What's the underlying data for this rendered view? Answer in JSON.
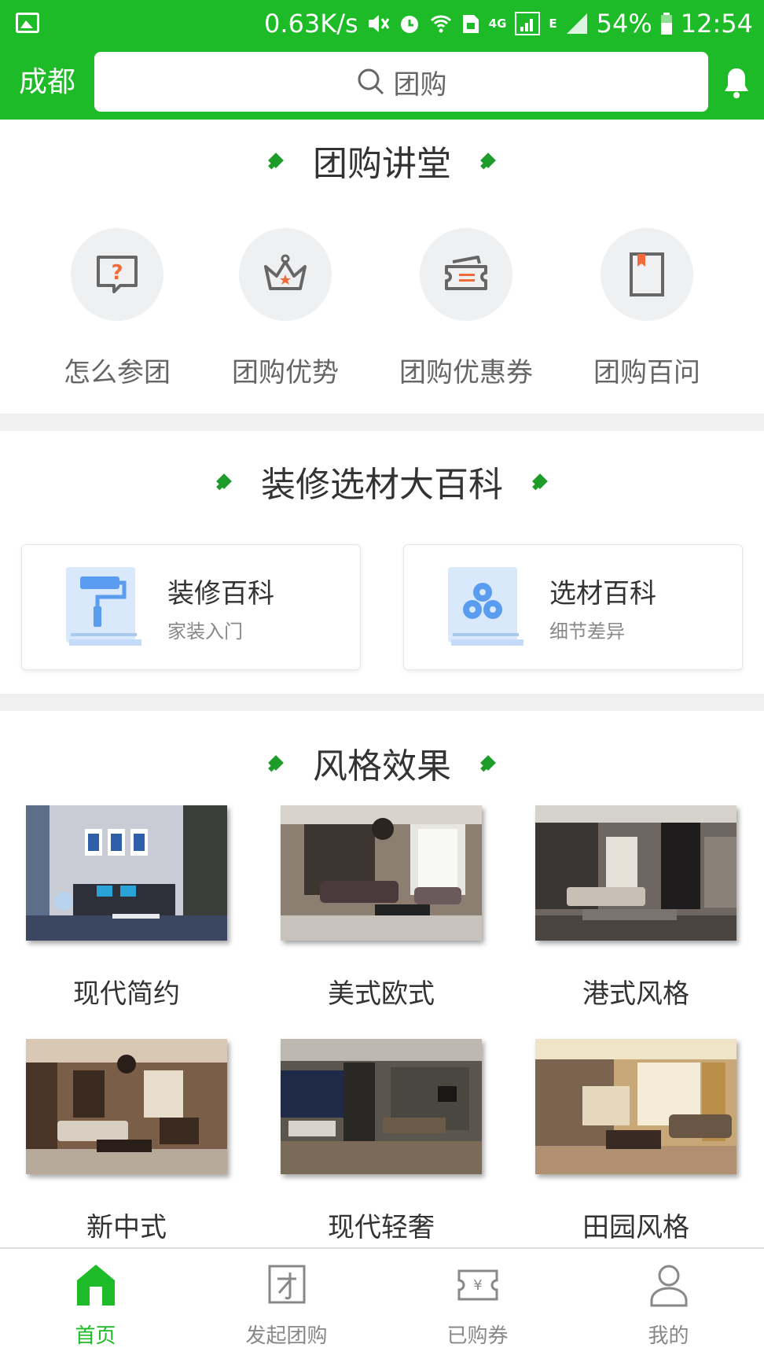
{
  "status_bar": {
    "net_speed": "0.63K/s",
    "net_type": "4G",
    "edge": "E",
    "battery": "54%",
    "time": "12:54"
  },
  "header": {
    "city": "成都",
    "search_placeholder": "团购",
    "accent_color": "#1dbb27"
  },
  "lecture": {
    "title": "团购讲堂",
    "items": [
      {
        "label": "怎么参团",
        "icon": "question-bubble-icon"
      },
      {
        "label": "团购优势",
        "icon": "crown-icon"
      },
      {
        "label": "团购优惠券",
        "icon": "coupon-icon"
      },
      {
        "label": "团购百问",
        "icon": "book-icon"
      }
    ]
  },
  "encyclopedia": {
    "title": "装修选材大百科",
    "cards": [
      {
        "title": "装修百科",
        "subtitle": "家装入门",
        "icon": "paint-roller-icon"
      },
      {
        "title": "选材百科",
        "subtitle": "细节差异",
        "icon": "material-rolls-icon"
      }
    ]
  },
  "styles": {
    "title": "风格效果",
    "items": [
      {
        "label": "现代简约"
      },
      {
        "label": "美式欧式"
      },
      {
        "label": "港式风格"
      },
      {
        "label": "新中式"
      },
      {
        "label": "现代轻奢"
      },
      {
        "label": "田园风格"
      }
    ]
  },
  "tabbar": {
    "items": [
      {
        "label": "首页",
        "icon": "home-icon",
        "active": true
      },
      {
        "label": "发起团购",
        "icon": "launch-group-icon",
        "active": false
      },
      {
        "label": "已购券",
        "icon": "purchased-coupon-icon",
        "active": false
      },
      {
        "label": "我的",
        "icon": "person-icon",
        "active": false
      }
    ]
  }
}
